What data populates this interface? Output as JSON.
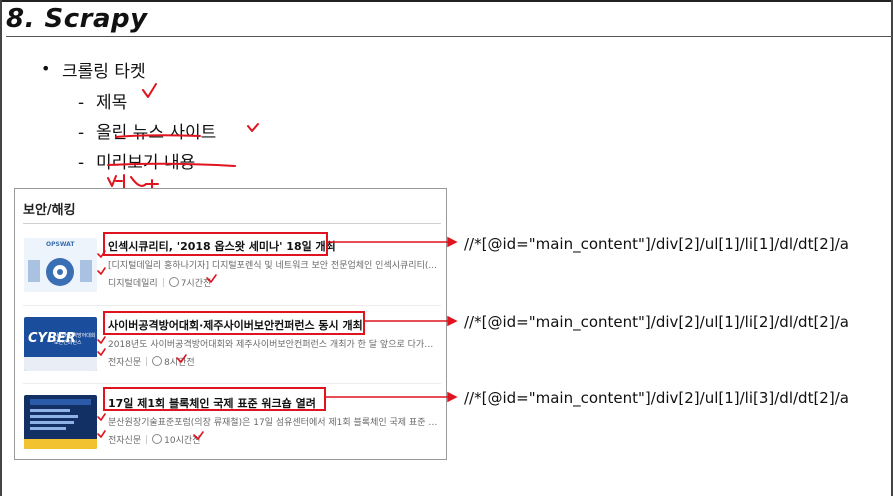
{
  "slide": {
    "title": "8. Scrapy",
    "bullet": "크롤링 타켓",
    "sub_items": [
      "제목",
      "올린 뉴스 사이트",
      "미리보기 내용"
    ],
    "dash": "-"
  },
  "card": {
    "section_title": "보안/해킹",
    "items": [
      {
        "headline": "인섹시큐리티, '2018 옵스왓 세미나' 18일 개최",
        "summary": "[디지털데일리 홍하나기자] 디지털포렌식 및 네트워크 보안 전문업체인 인섹시큐리티(...",
        "source": "디지털데일리",
        "time": "7시간전",
        "thumb_label": "OPSWAT"
      },
      {
        "headline": "사이버공격방어대회·제주사이버보안컨퍼런스 동시 개최",
        "summary": "2018년도 사이버공격방어대회와 제주사이버보안컨퍼런스 개최가 한 달 앞으로 다가왔...",
        "source": "전자신문",
        "time": "8시간전",
        "thumb_label": "CYBER",
        "thumb_sub": "사이버공격방어대회 보안컨퍼런스"
      },
      {
        "headline": "17일 제1회 블록체인 국제 표준 워크숍 열려",
        "summary": "분산원장기술표준포럼(의장 류재철)은 17일 섬유센터에서 제1회 블록체인 국제 표준 워...",
        "source": "전자신문",
        "time": "10시간전"
      }
    ]
  },
  "xpaths": [
    "//*[@id=\"main_content\"]/div[2]/ul[1]/li[1]/dl/dt[2]/a",
    "//*[@id=\"main_content\"]/div[2]/ul[1]/li[2]/dl/dt[2]/a",
    "//*[@id=\"main_content\"]/div[2]/ul[1]/li[3]/dl/dt[2]/a"
  ],
  "colors": {
    "annotation_red": "#e0141e"
  }
}
